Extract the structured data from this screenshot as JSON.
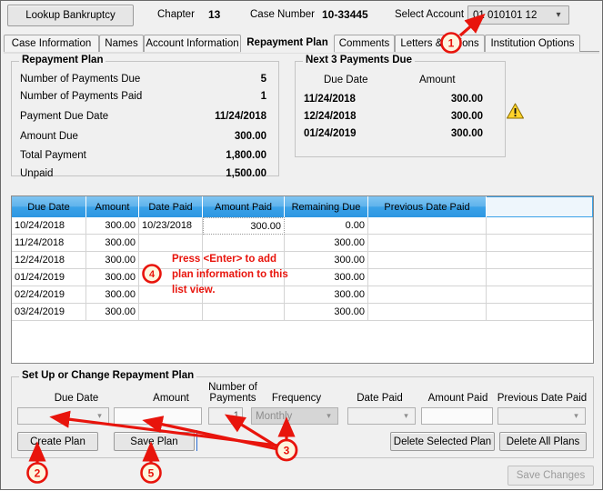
{
  "window": {
    "lookup_button": "Lookup Bankruptcy",
    "chapter_label": "Chapter",
    "chapter_value": "13",
    "case_number_label": "Case Number",
    "case_number_value": "10-33445",
    "select_account_label": "Select Account",
    "select_account_value": "01 010101 12"
  },
  "tabs": [
    {
      "label": "Case Information",
      "active": false
    },
    {
      "label": "Names",
      "active": false
    },
    {
      "label": "Account Information",
      "active": false
    },
    {
      "label": "Repayment Plan",
      "active": true
    },
    {
      "label": "Comments",
      "active": false
    },
    {
      "label": "Letters & Actions",
      "active": false
    },
    {
      "label": "Institution Options",
      "active": false
    }
  ],
  "repayment_plan": {
    "title": "Repayment Plan",
    "rows": [
      {
        "label": "Number of Payments Due",
        "value": "5"
      },
      {
        "label": "Number of Payments Paid",
        "value": "1"
      },
      {
        "label": "Payment Due Date",
        "value": "11/24/2018"
      },
      {
        "label": "Amount Due",
        "value": "300.00"
      },
      {
        "label": "Total Payment",
        "value": "1,800.00"
      },
      {
        "label": "Unpaid",
        "value": "1,500.00"
      }
    ]
  },
  "next_payments": {
    "title": "Next 3 Payments Due",
    "col_due_date": "Due Date",
    "col_amount": "Amount",
    "rows": [
      {
        "due_date": "11/24/2018",
        "amount": "300.00"
      },
      {
        "due_date": "12/24/2018",
        "amount": "300.00"
      },
      {
        "due_date": "01/24/2019",
        "amount": "300.00"
      }
    ],
    "warning_icon": "warning-triangle-icon"
  },
  "grid": {
    "columns": [
      "Due Date",
      "Amount",
      "Date Paid",
      "Amount Paid",
      "Remaining Due",
      "Previous Date Paid",
      ""
    ],
    "rows": [
      {
        "due_date": "10/24/2018",
        "amount": "300.00",
        "date_paid": "10/23/2018",
        "amount_paid": "300.00",
        "remaining_due": "0.00",
        "previous_date_paid": "",
        "extra": ""
      },
      {
        "due_date": "11/24/2018",
        "amount": "300.00",
        "date_paid": "",
        "amount_paid": "",
        "remaining_due": "300.00",
        "previous_date_paid": "",
        "extra": ""
      },
      {
        "due_date": "12/24/2018",
        "amount": "300.00",
        "date_paid": "",
        "amount_paid": "",
        "remaining_due": "300.00",
        "previous_date_paid": "",
        "extra": ""
      },
      {
        "due_date": "01/24/2019",
        "amount": "300.00",
        "date_paid": "",
        "amount_paid": "",
        "remaining_due": "300.00",
        "previous_date_paid": "",
        "extra": ""
      },
      {
        "due_date": "02/24/2019",
        "amount": "300.00",
        "date_paid": "",
        "amount_paid": "",
        "remaining_due": "300.00",
        "previous_date_paid": "",
        "extra": ""
      },
      {
        "due_date": "03/24/2019",
        "amount": "300.00",
        "date_paid": "",
        "amount_paid": "",
        "remaining_due": "300.00",
        "previous_date_paid": "",
        "extra": ""
      }
    ]
  },
  "setup": {
    "title": "Set Up or Change Repayment Plan",
    "labels": {
      "due_date": "Due Date",
      "amount": "Amount",
      "number_of_payments_line1": "Number of",
      "number_of_payments_line2": "Payments",
      "frequency": "Frequency",
      "date_paid": "Date Paid",
      "amount_paid": "Amount Paid",
      "previous_date_paid": "Previous Date Paid"
    },
    "values": {
      "due_date": "",
      "amount": "",
      "number_of_payments": "1",
      "frequency": "Monthly",
      "date_paid": "",
      "amount_paid": "",
      "previous_date_paid": ""
    },
    "buttons": {
      "create_plan": "Create Plan",
      "save_plan": "Save Plan",
      "delete_selected_plan": "Delete Selected Plan",
      "delete_all_plans": "Delete All Plans"
    }
  },
  "footer": {
    "save_changes": "Save Changes"
  },
  "annotations": {
    "markers": [
      "1",
      "2",
      "3",
      "4",
      "5"
    ],
    "callout_line1": "Press <Enter> to add",
    "callout_line2": "plan information to this",
    "callout_line3": "list view.",
    "color": "#e8140c"
  }
}
